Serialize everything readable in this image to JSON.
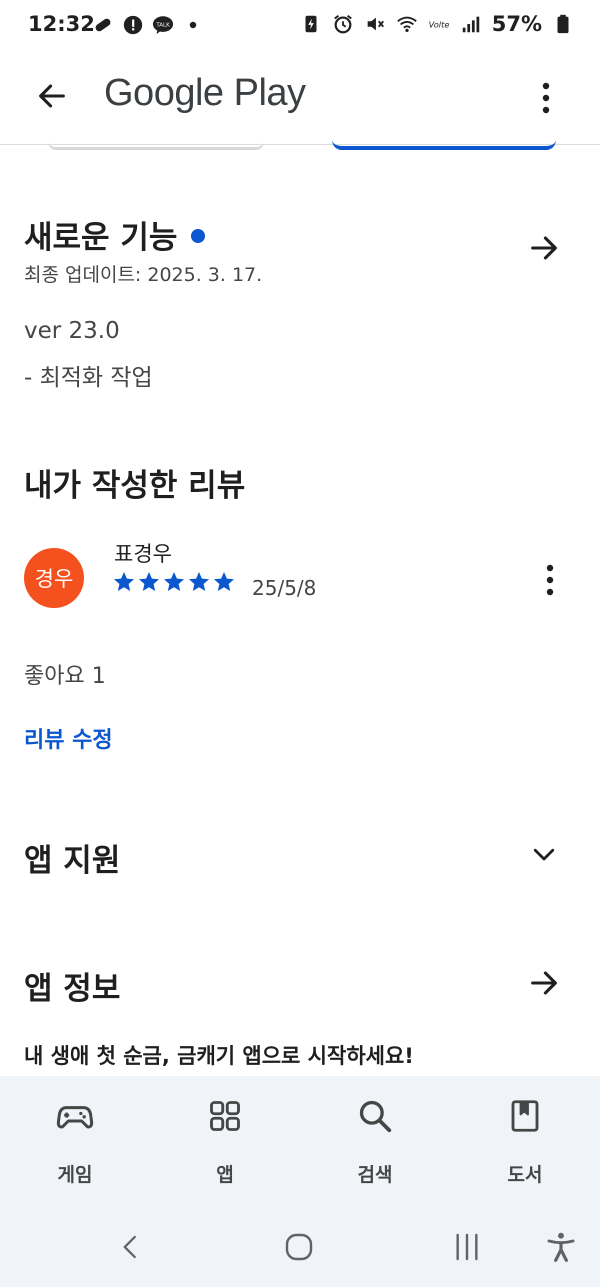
{
  "status_bar": {
    "time": "12:32",
    "battery": "57%",
    "left_icons": [
      "pill-icon",
      "alert-icon",
      "kakaotalk-icon",
      "dot-icon"
    ],
    "right_icons": [
      "battery-saver-icon",
      "alarm-icon",
      "mute-icon",
      "wifi-icon",
      "volte-icon",
      "signal-icon",
      "battery-icon"
    ]
  },
  "app_bar": {
    "title": "Google Play"
  },
  "whats_new": {
    "title": "새로운 기능",
    "updated": "최종 업데이트: 2025. 3. 17.",
    "version": "ver 23.0",
    "note": "- 최적화 작업"
  },
  "my_review": {
    "title": "내가 작성한 리뷰",
    "avatar_text": "경우",
    "reviewer": "표경우",
    "rating": 5,
    "max_rating": 5,
    "date": "25/5/8",
    "likes": "좋아요 1",
    "edit_label": "리뷰 수정"
  },
  "app_support": {
    "title": "앱 지원"
  },
  "app_info": {
    "title": "앱 정보",
    "promo": "내 생애 첫 순금, 금캐기 앱으로 시작하세요!"
  },
  "bottom_nav": [
    {
      "label": "게임",
      "icon": "gamepad-icon"
    },
    {
      "label": "앱",
      "icon": "apps-grid-icon"
    },
    {
      "label": "검색",
      "icon": "search-icon"
    },
    {
      "label": "도서",
      "icon": "book-icon"
    }
  ],
  "colors": {
    "accent": "#0b57d0",
    "avatar": "#f4511e",
    "nav_background": "#f0f4f9"
  }
}
